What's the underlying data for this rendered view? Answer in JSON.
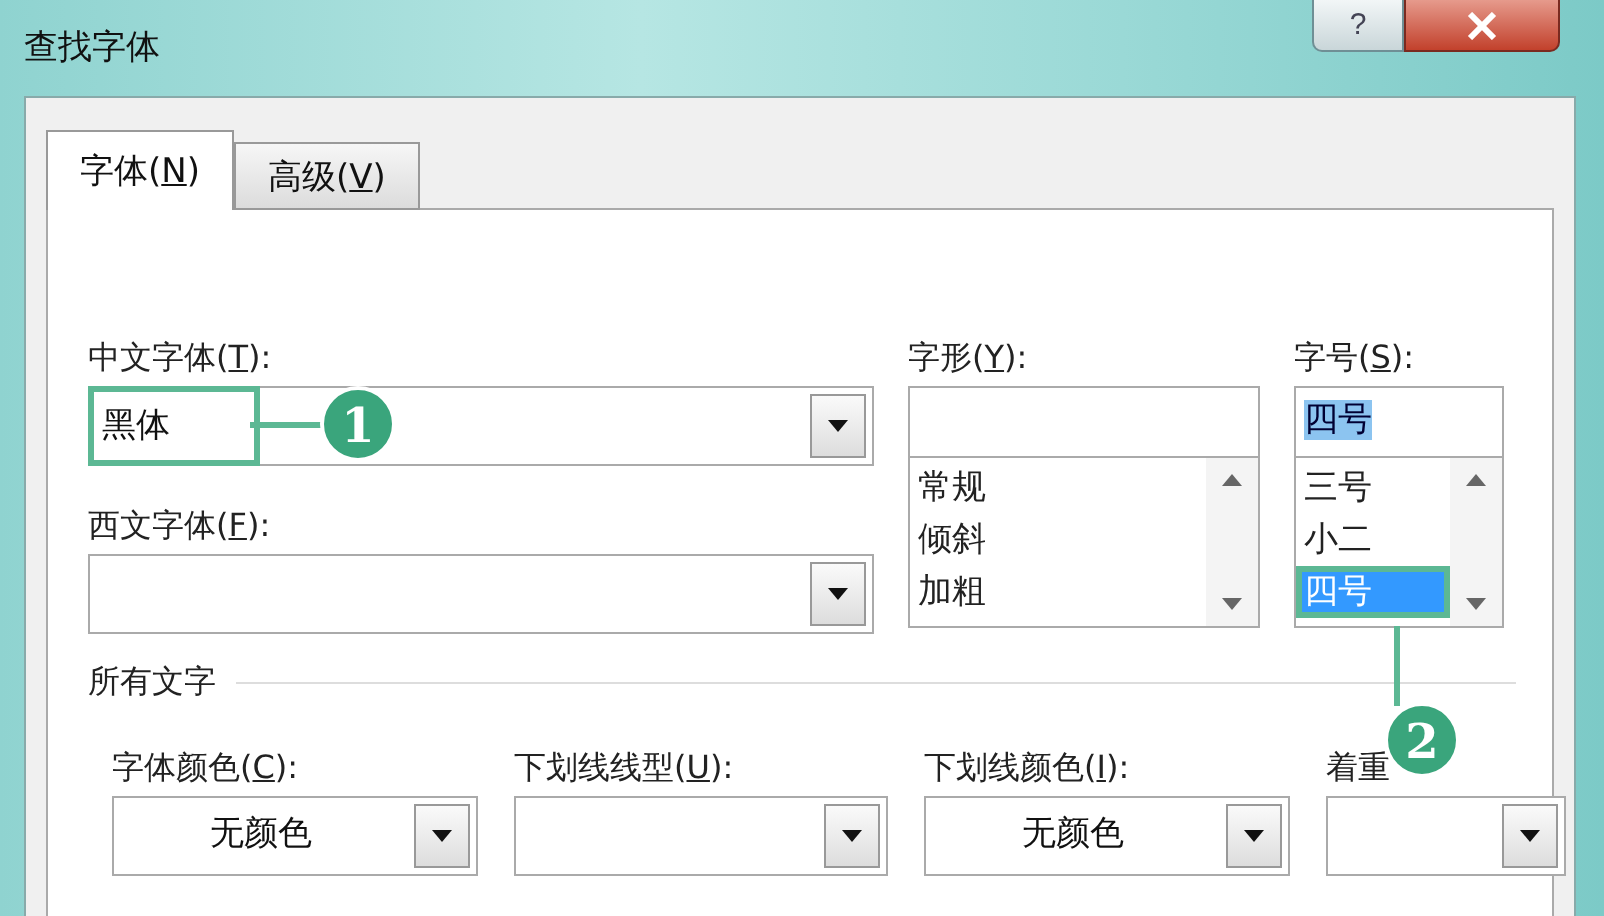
{
  "window": {
    "title": "查找字体",
    "help": "?"
  },
  "tabs": [
    {
      "before": "字体(",
      "key": "N",
      "after": ")",
      "selected": true
    },
    {
      "before": "高级(",
      "key": "V",
      "after": ")",
      "selected": false
    }
  ],
  "chinese_font": {
    "label": {
      "before": "中文字体(",
      "key": "T",
      "after": "):"
    },
    "value": "黑体",
    "highlighted": true
  },
  "western_font": {
    "label": {
      "before": "西文字体(",
      "key": "F",
      "after": "):"
    }
  },
  "style": {
    "label": {
      "before": "字形(",
      "key": "Y",
      "after": "):"
    },
    "options": [
      {
        "text": "常规",
        "selected": false
      },
      {
        "text": "倾斜",
        "selected": false
      },
      {
        "text": "加粗",
        "selected": false
      }
    ]
  },
  "size": {
    "label": {
      "before": "字号(",
      "key": "S",
      "after": "):"
    },
    "value": "四号",
    "value_highlighted": true,
    "options": [
      {
        "text": "三号",
        "selected": false
      },
      {
        "text": "小二",
        "selected": false
      },
      {
        "text": "四号",
        "selected": true,
        "highlighted": true
      }
    ]
  },
  "all_text": {
    "title": "所有文字",
    "fields": [
      {
        "label": {
          "before": "字体颜色(",
          "key": "C",
          "after": "):"
        },
        "value": "无颜色"
      },
      {
        "label": {
          "before": "下划线线型(",
          "key": "U",
          "after": "):"
        }
      },
      {
        "label": {
          "before": "下划线颜色(",
          "key": "I",
          "after": "):"
        },
        "value": "无颜色"
      },
      {
        "label": {
          "before": "着重"
        }
      }
    ]
  },
  "callouts": [
    {
      "number": "1"
    },
    {
      "number": "2"
    }
  ]
}
